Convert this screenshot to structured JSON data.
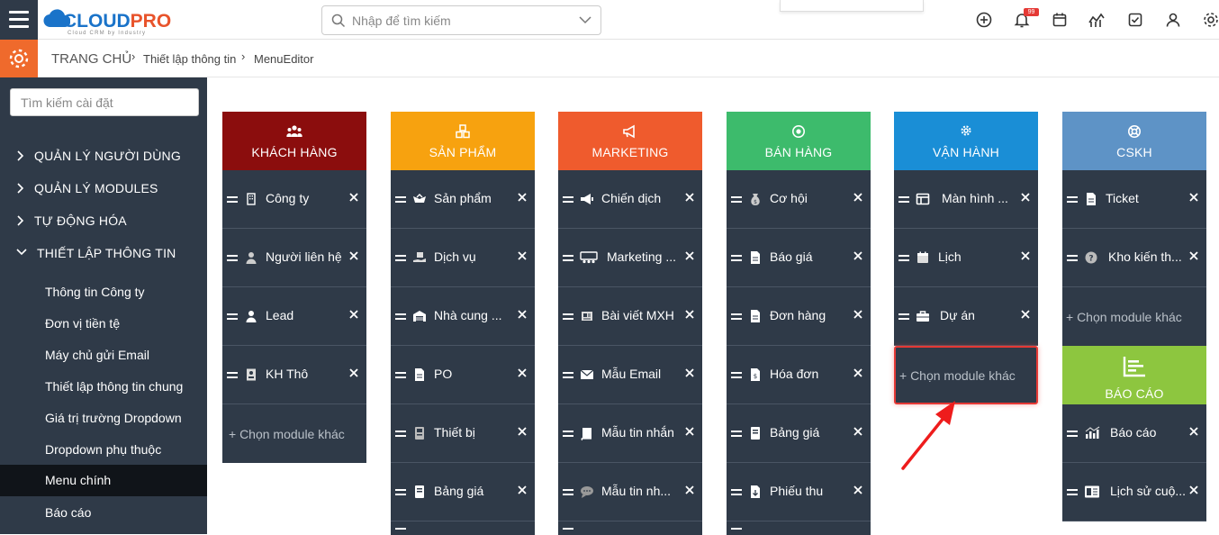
{
  "brand": {
    "name_part1": "CLOUD",
    "name_part2": "PRO",
    "tagline": "Cloud CRM by Industry"
  },
  "search": {
    "placeholder": "Nhập để tìm kiếm"
  },
  "notifications": {
    "badge": "99"
  },
  "breadcrumb": {
    "home": "TRANG CHỦ",
    "level1": "Thiết lập thông tin",
    "level2": "MenuEditor"
  },
  "sidebar": {
    "search_placeholder": "Tìm kiếm cài đặt",
    "groups": [
      "QUẢN LÝ NGƯỜI DÙNG",
      "QUẢN LÝ MODULES",
      "TỰ ĐỘNG HÓA",
      "THIẾT LẬP THÔNG TIN"
    ],
    "subitems": [
      "Thông tin Công ty",
      "Đơn vị tiền tệ",
      "Máy chủ gửi Email",
      "Thiết lập thông tin chung",
      "Giá trị trường Dropdown",
      "Dropdown phụ thuộc",
      "Menu chính",
      "Báo cáo"
    ],
    "active": "Menu chính"
  },
  "add_module_label": "+ Chọn module khác",
  "columns": [
    {
      "title": "KHÁCH HÀNG",
      "color": "#8b0d0d",
      "icon": "users-icon",
      "items": [
        "Công ty",
        "Người liên hệ",
        "Lead",
        "KH Thô"
      ]
    },
    {
      "title": "SẢN PHẨM",
      "color": "#f7a20f",
      "icon": "boxes-icon",
      "items": [
        "Sản phẩm",
        "Dịch vụ",
        "Nhà cung ...",
        "PO",
        "Thiết bị",
        "Bảng giá",
        ""
      ]
    },
    {
      "title": "MARKETING",
      "color": "#ef5b2d",
      "icon": "megaphone-icon",
      "items": [
        "Chiến dịch",
        "Marketing ...",
        "Bài viết MXH",
        "Mẫu Email",
        "Mẫu tin nhắn",
        "Mẫu tin nh...",
        ""
      ]
    },
    {
      "title": "BÁN HÀNG",
      "color": "#3dbb6c",
      "icon": "target-icon",
      "items": [
        "Cơ hội",
        "Báo giá",
        "Đơn hàng",
        "Hóa đơn",
        "Bảng giá",
        "Phiếu thu",
        ""
      ]
    },
    {
      "title": "VẬN HÀNH",
      "color": "#1a8ed6",
      "icon": "cog-icon",
      "items": [
        "Màn hình ...",
        "Lịch",
        "Dự án"
      ]
    },
    {
      "title": "CSKH",
      "color": "#5e93c6",
      "icon": "lifebuoy-icon",
      "items": [
        "Ticket",
        "Kho kiến th..."
      ]
    },
    {
      "title": "BÁO CÁO",
      "color": "#8dc63f",
      "icon": "bar-chart-icon",
      "items": [
        "Báo cáo",
        "Lịch sử cuộ..."
      ]
    }
  ]
}
